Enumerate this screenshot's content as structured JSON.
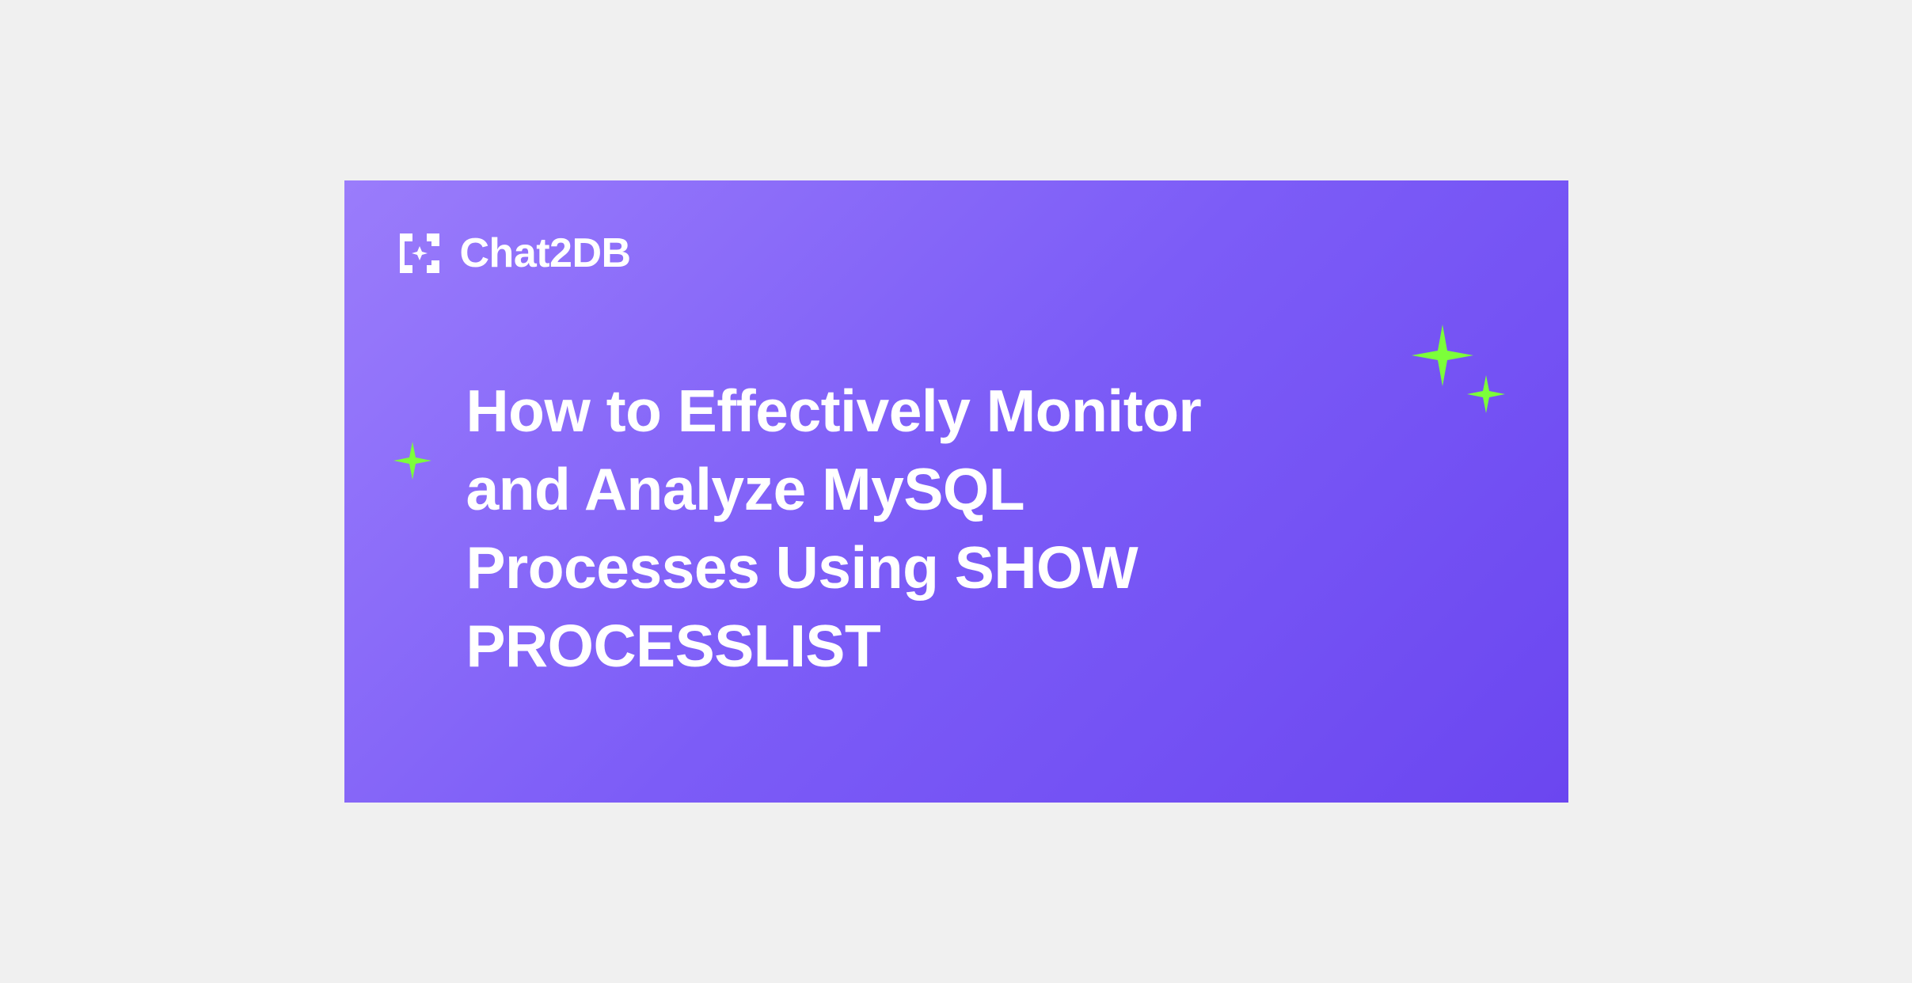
{
  "brand": {
    "name": "Chat2DB"
  },
  "content": {
    "headline": "How to Effectively Monitor and Analyze MySQL Processes Using SHOW PROCESSLIST"
  },
  "colors": {
    "background_gradient_start": "#9a7cfb",
    "background_gradient_end": "#6b46f0",
    "text": "#ffffff",
    "accent_star": "#7cff3a"
  }
}
